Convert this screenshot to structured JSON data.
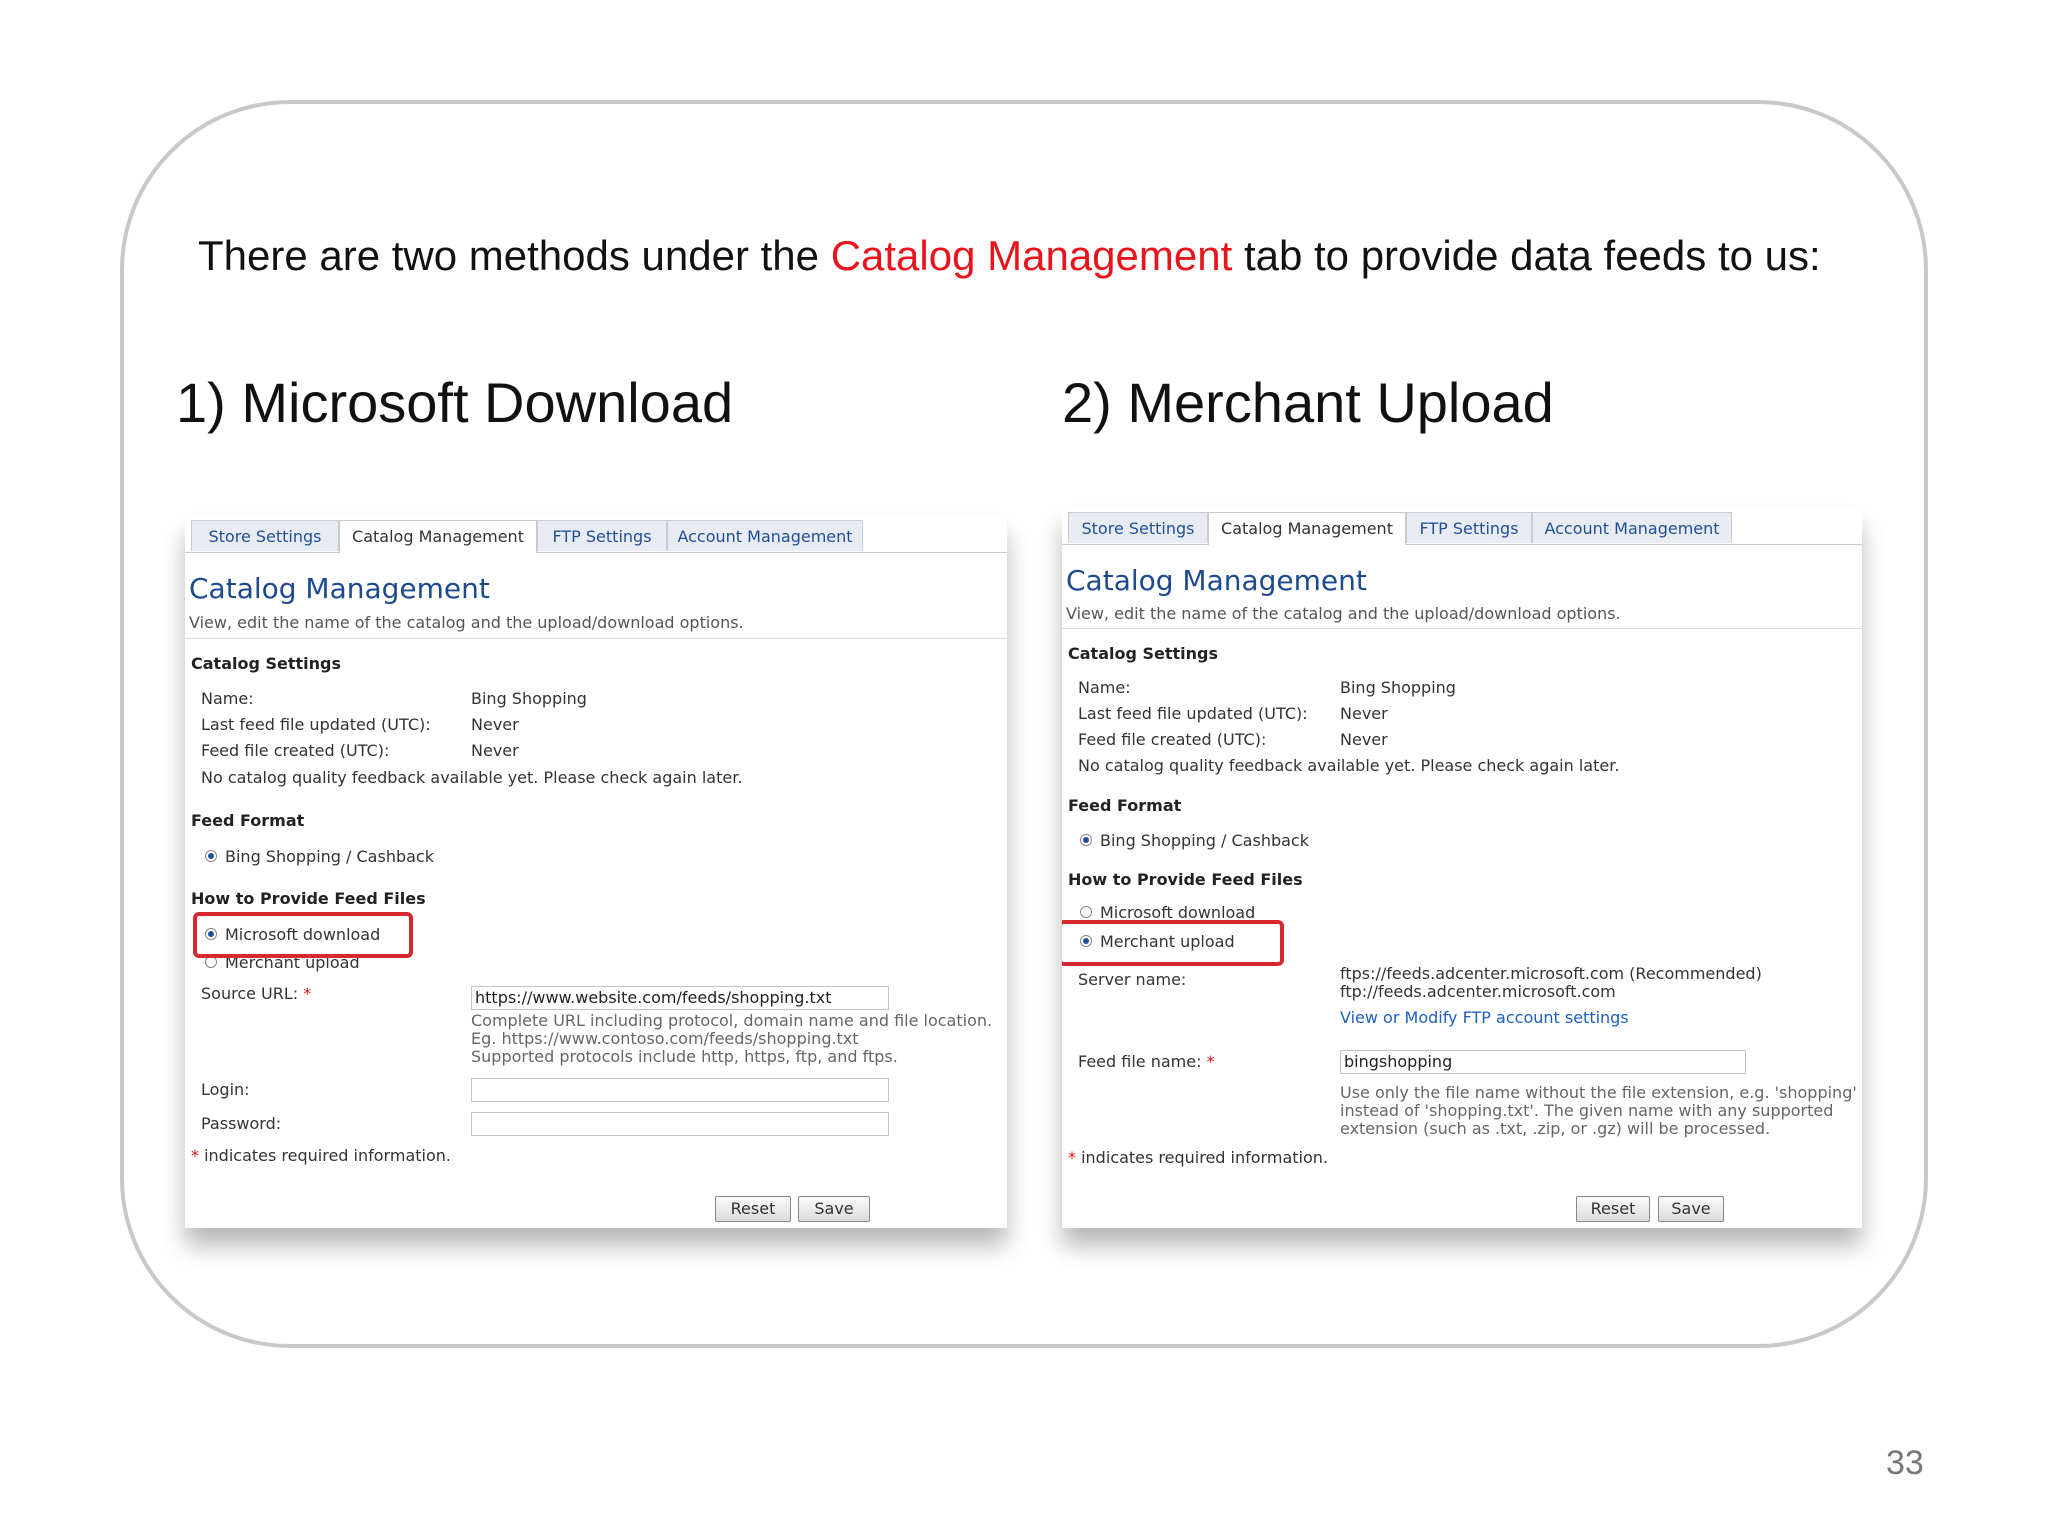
{
  "intro": {
    "before": "There are two methods under the ",
    "highlight": "Catalog Management",
    "after": " tab to provide data feeds to us:"
  },
  "colors": {
    "highlight_text": "#e8141c",
    "highlight_box": "#d8282f",
    "tab_link": "#1f4f96",
    "title": "#1d4a8f"
  },
  "headings": {
    "method1": "1) Microsoft Download",
    "method2": "2) Merchant Upload"
  },
  "slide_number": "33",
  "tabs": [
    "Store Settings",
    "Catalog Management",
    "FTP Settings",
    "Account Management"
  ],
  "common": {
    "title": "Catalog Management",
    "subtitle": "View, edit the name of the catalog and the upload/download options.",
    "catalog_settings": "Catalog Settings",
    "name_label": "Name:",
    "name_value": "Bing Shopping",
    "last_updated_label": "Last feed file updated (UTC):",
    "last_updated_value": "Never",
    "created_label": "Feed file created (UTC):",
    "created_value": "Never",
    "quality_note": "No catalog quality feedback available yet. Please check again later.",
    "feed_format": "Feed Format",
    "feed_format_option": "Bing Shopping / Cashback",
    "how_to_provide": "How to Provide Feed Files",
    "option_microsoft": "Microsoft download",
    "option_merchant": "Merchant upload",
    "required_mark": "*",
    "required_note": "indicates required information.",
    "reset": "Reset",
    "save": "Save"
  },
  "shot1": {
    "source_url_label": "Source URL:",
    "source_url_value": "https://www.website.com/feeds/shopping.txt",
    "hint1": "Complete URL including protocol, domain name and file location.",
    "hint2": "Eg. https://www.contoso.com/feeds/shopping.txt",
    "hint3": "Supported protocols include http, https, ftp, and ftps.",
    "login_label": "Login:",
    "login_value": "",
    "password_label": "Password:",
    "password_value": ""
  },
  "shot2": {
    "server_name_label": "Server name:",
    "server1": "ftps://feeds.adcenter.microsoft.com (Recommended)",
    "server2": "ftp://feeds.adcenter.microsoft.com",
    "ftp_link": "View or Modify FTP account settings",
    "feed_file_label": "Feed file name:",
    "feed_file_value": "bingshopping",
    "hint1": "Use only the file name without the file extension, e.g. 'shopping'",
    "hint2": "instead of 'shopping.txt'. The given name with any supported",
    "hint3": "extension (such as .txt, .zip, or .gz) will be processed."
  }
}
